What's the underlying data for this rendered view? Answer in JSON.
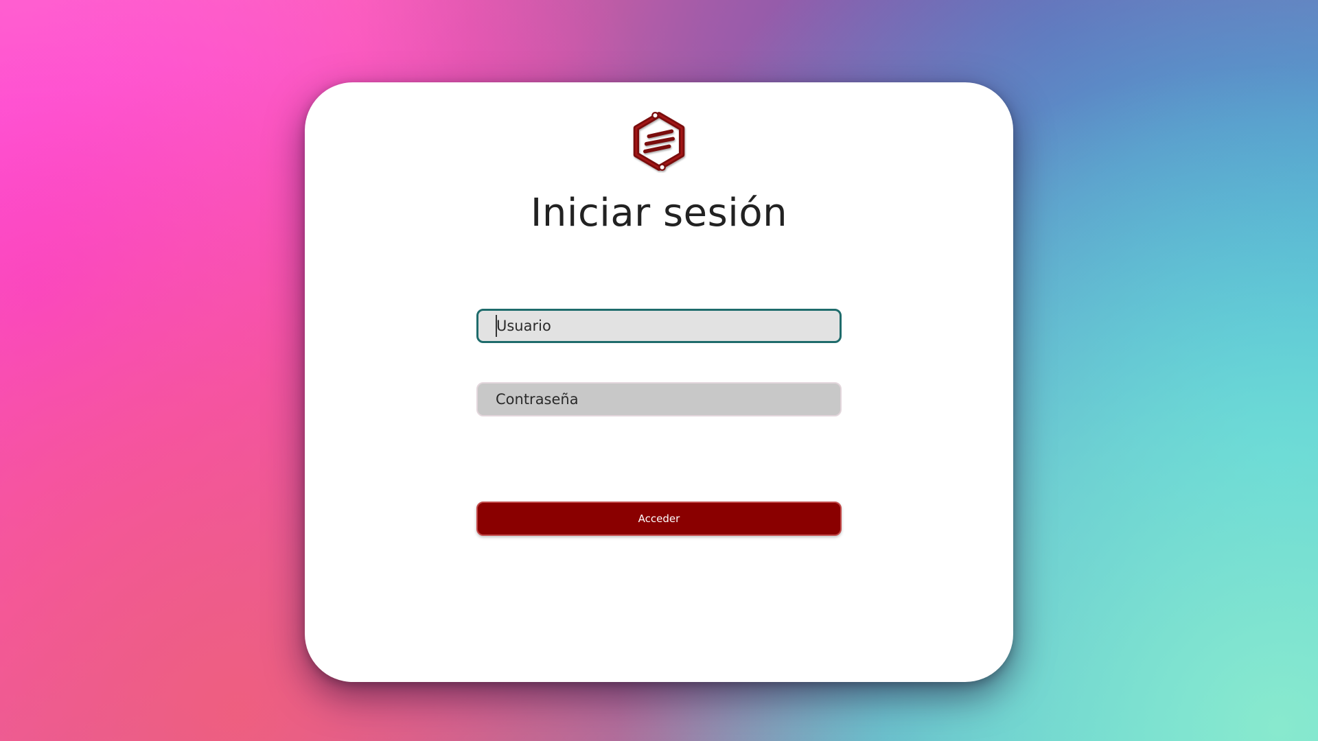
{
  "login": {
    "title": "Iniciar sesión",
    "username_placeholder": "Usuario",
    "password_placeholder": "Contraseña",
    "submit_label": "Acceder"
  },
  "logo": {
    "icon": "hexagon-logo-icon",
    "color": "#7a0a0a"
  },
  "colors": {
    "accent_button": "#8a0000",
    "focused_border": "#1e6b6b",
    "card_background": "#ffffff"
  }
}
